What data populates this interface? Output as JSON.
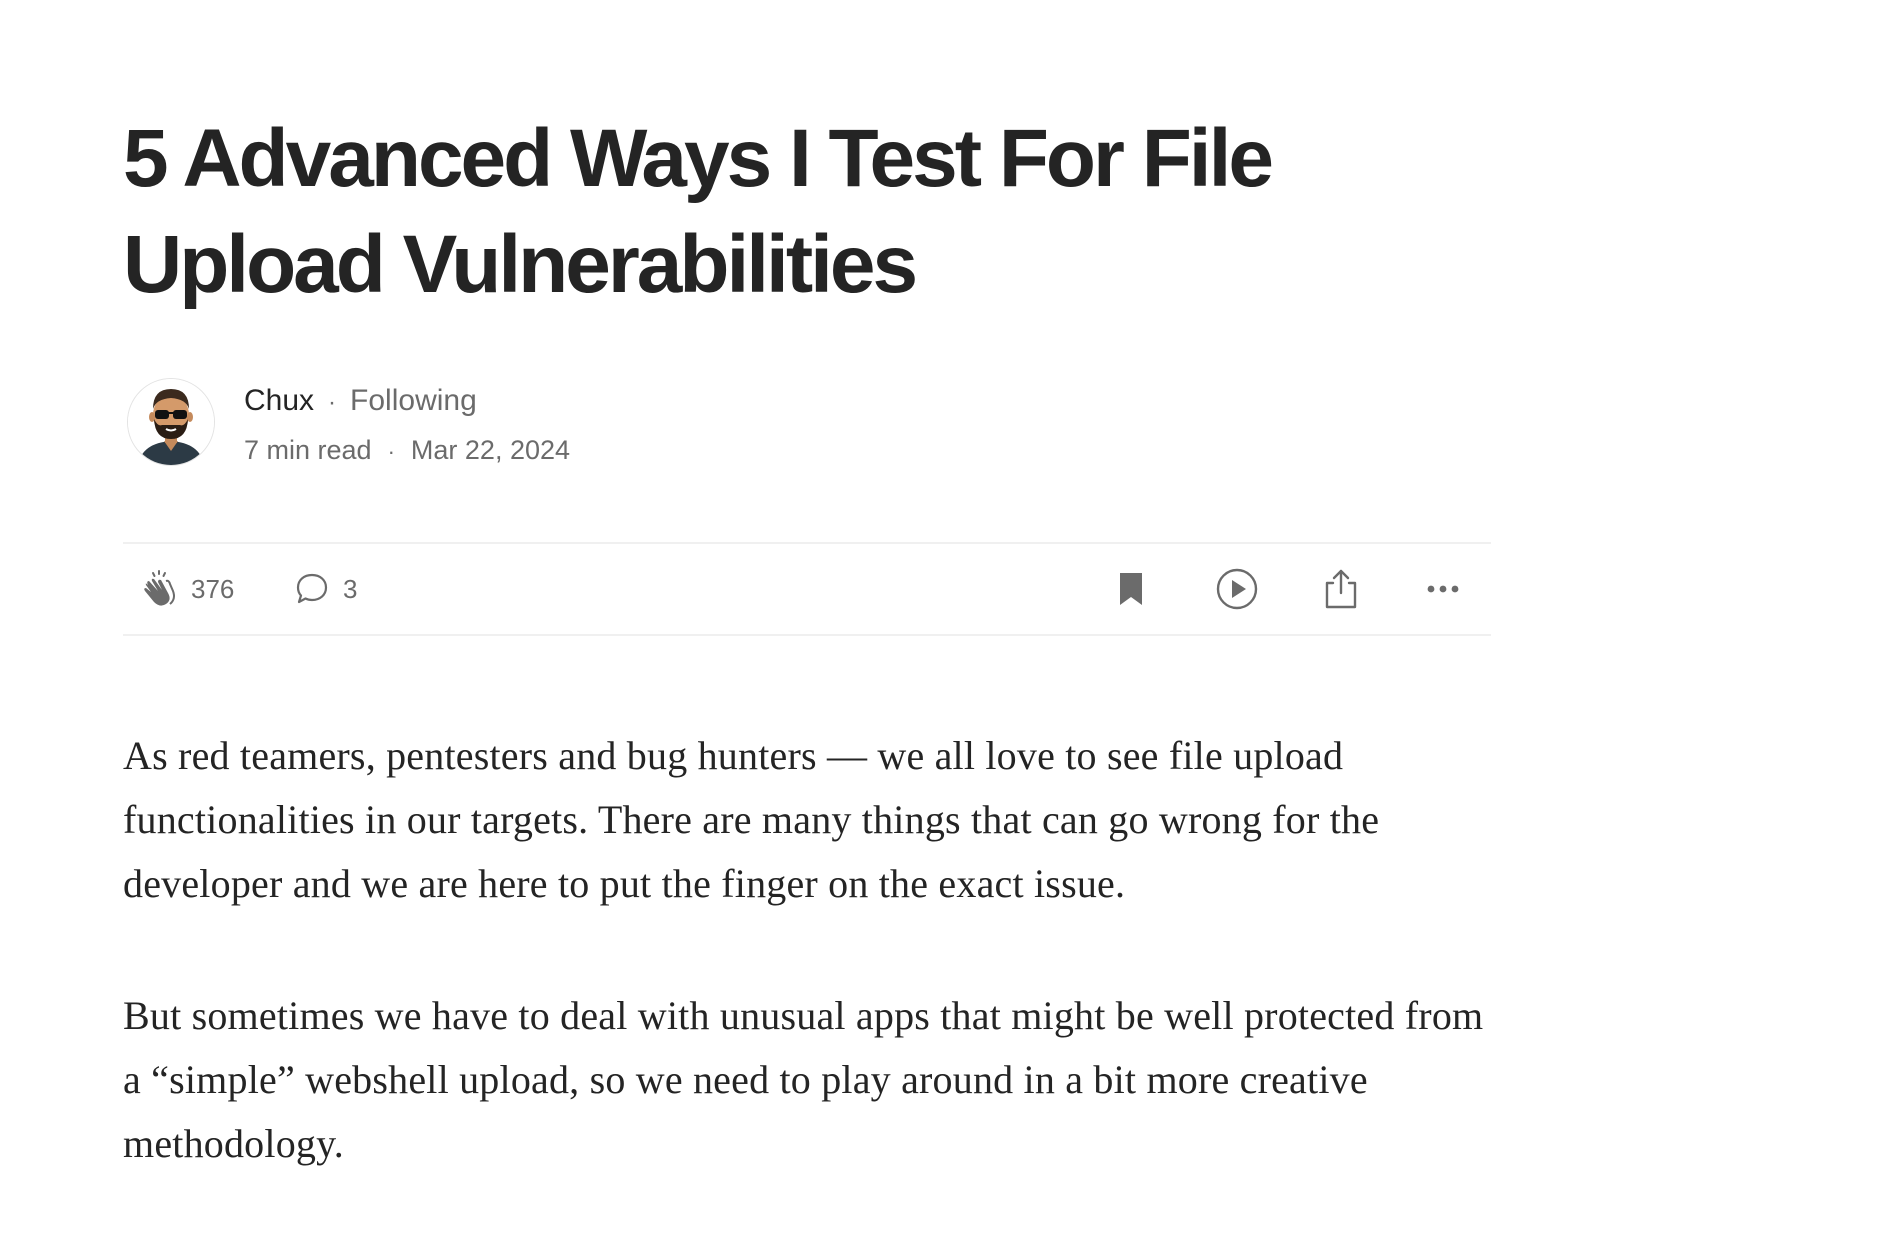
{
  "article": {
    "title": "5 Advanced Ways I Test For File Upload Vulnerabilities",
    "author": {
      "name": "Chux",
      "follow_status": "Following",
      "read_time": "7 min read",
      "date": "Mar 22, 2024",
      "separator": "·"
    },
    "actions": {
      "claps": "376",
      "comments": "3",
      "icons": [
        "clap-icon",
        "comment-icon",
        "bookmark-icon",
        "play-icon",
        "share-icon",
        "more-icon"
      ]
    },
    "paragraphs": [
      "As red teamers, pentesters and bug hunters — we all love to see file upload functionalities in our targets. There are many things that can go wrong for the developer and we are here to put the finger on the exact issue.",
      "But sometimes we have to deal with unusual apps that might be well protected from a “simple” webshell upload, so we need to play around in a bit more creative methodology."
    ]
  },
  "colors": {
    "text": "#242424",
    "muted": "#6b6b6b",
    "divider": "#f0f0f0"
  }
}
